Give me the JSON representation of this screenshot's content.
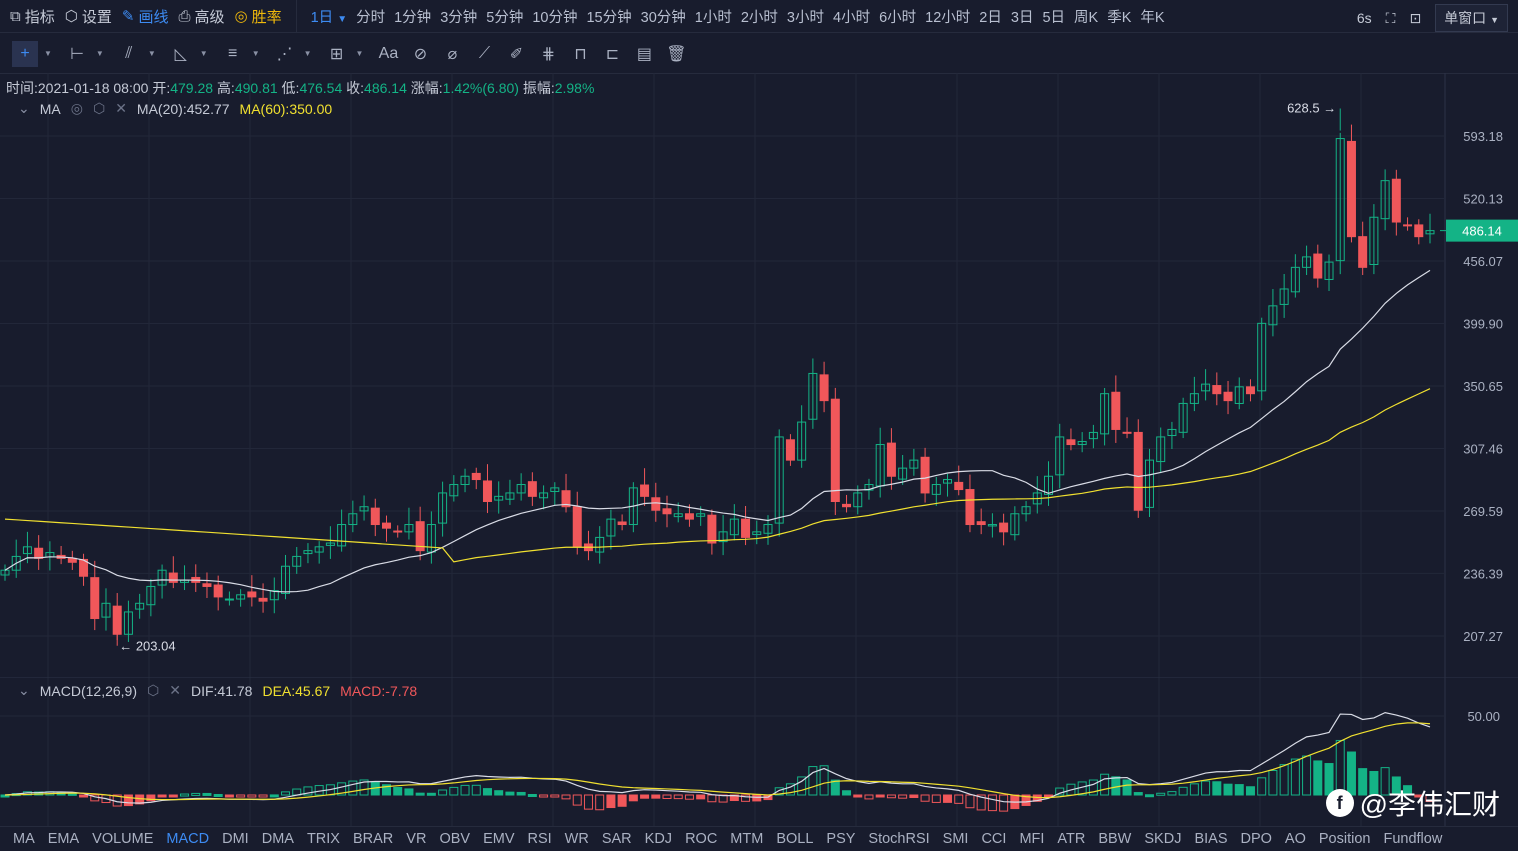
{
  "topbar": {
    "menu": [
      {
        "label": "指标",
        "icon": "chart-icon"
      },
      {
        "label": "设置",
        "icon": "gear-icon"
      },
      {
        "label": "画线",
        "icon": "pencil-icon"
      },
      {
        "label": "高级",
        "icon": "printer-icon"
      },
      {
        "label": "胜率",
        "icon": "target-icon"
      }
    ],
    "active_period": "1日",
    "periods": [
      "分时",
      "1分钟",
      "3分钟",
      "5分钟",
      "10分钟",
      "15分钟",
      "30分钟",
      "1小时",
      "2小时",
      "3小时",
      "4小时",
      "6小时",
      "12小时",
      "2日",
      "3日",
      "5日",
      "周K",
      "季K",
      "年K"
    ],
    "refresh": "6s",
    "window_mode": "单窗口"
  },
  "toolbar": {
    "tools": [
      "crosshair-icon",
      "horizontal-line-icon",
      "trend-line-icon",
      "angle-icon",
      "parallel-lines-icon",
      "fibonacci-icon",
      "rectangle-icon",
      "text-icon",
      "ruler-icon",
      "eraser-icon",
      "measure-icon",
      "brush-icon",
      "pattern-icon",
      "lock-icon",
      "bookmark-icon",
      "clipboard-icon",
      "trash-icon"
    ],
    "text_tool": "Aa"
  },
  "info": {
    "time_label": "时间:",
    "time": "2021-01-18 08:00",
    "open_label": "开:",
    "open": "479.28",
    "high_label": "高:",
    "high": "490.81",
    "low_label": "低:",
    "low": "476.54",
    "close_label": "收:",
    "close": "486.14",
    "change_label": "涨幅:",
    "change": "1.42%(6.80)",
    "amp_label": "振幅:",
    "amp": "2.98%"
  },
  "ma": {
    "name": "MA",
    "ma20": "MA(20):452.77",
    "ma60": "MA(60):350.00"
  },
  "macd": {
    "name": "MACD(12,26,9)",
    "dif": "DIF:41.78",
    "dea": "DEA:45.67",
    "macd": "MACD:-7.78",
    "axis_label": "50.00"
  },
  "price_axis": [
    "593.18",
    "520.13",
    "456.07",
    "399.90",
    "350.65",
    "307.46",
    "269.59",
    "236.39",
    "207.27"
  ],
  "current_price": "486.14",
  "max_label": "628.5 →",
  "min_label": "← 203.04",
  "colors": {
    "up": "#14b386",
    "down": "#f0575a",
    "ma20": "#d9dce6",
    "ma60": "#f0e030",
    "accent": "#3d8bf2"
  },
  "chart_data": {
    "type": "candlestick",
    "max": 628.5,
    "min": 203.04,
    "closes": [
      238,
      245,
      250,
      244,
      247,
      244,
      242,
      235,
      215,
      222,
      208,
      218,
      222,
      230,
      238,
      232,
      233,
      232,
      230,
      225,
      224,
      226,
      225,
      223,
      228,
      240,
      245,
      248,
      250,
      252,
      262,
      268,
      272,
      262,
      260,
      258,
      262,
      248,
      262,
      280,
      285,
      290,
      288,
      275,
      278,
      280,
      285,
      278,
      280,
      283,
      272,
      250,
      248,
      255,
      265,
      262,
      283,
      278,
      270,
      268,
      268,
      265,
      268,
      252,
      258,
      265,
      255,
      258,
      262,
      315,
      300,
      325,
      360,
      340,
      275,
      272,
      280,
      285,
      310,
      290,
      295,
      300,
      280,
      285,
      288,
      282,
      262,
      262,
      262,
      258,
      268,
      272,
      280,
      290,
      315,
      310,
      312,
      318,
      345,
      320,
      318,
      270,
      300,
      315,
      320,
      338,
      345,
      352,
      345,
      340,
      350,
      345,
      400,
      415,
      430,
      450,
      460,
      440,
      455,
      590,
      480,
      450,
      500,
      540,
      495,
      492,
      480,
      486.14
    ]
  },
  "indicator_tabs": [
    "MA",
    "EMA",
    "VOLUME",
    "MACD",
    "DMI",
    "DMA",
    "TRIX",
    "BRAR",
    "VR",
    "OBV",
    "EMV",
    "RSI",
    "WR",
    "SAR",
    "KDJ",
    "ROC",
    "MTM",
    "BOLL",
    "PSY",
    "StochRSI",
    "SMI",
    "CCI",
    "MFI",
    "ATR",
    "BBW",
    "SKDJ",
    "BIAS",
    "DPO",
    "AO",
    "Position",
    "Fundflow"
  ],
  "active_tab": "MACD",
  "watermark": "@李伟汇财"
}
